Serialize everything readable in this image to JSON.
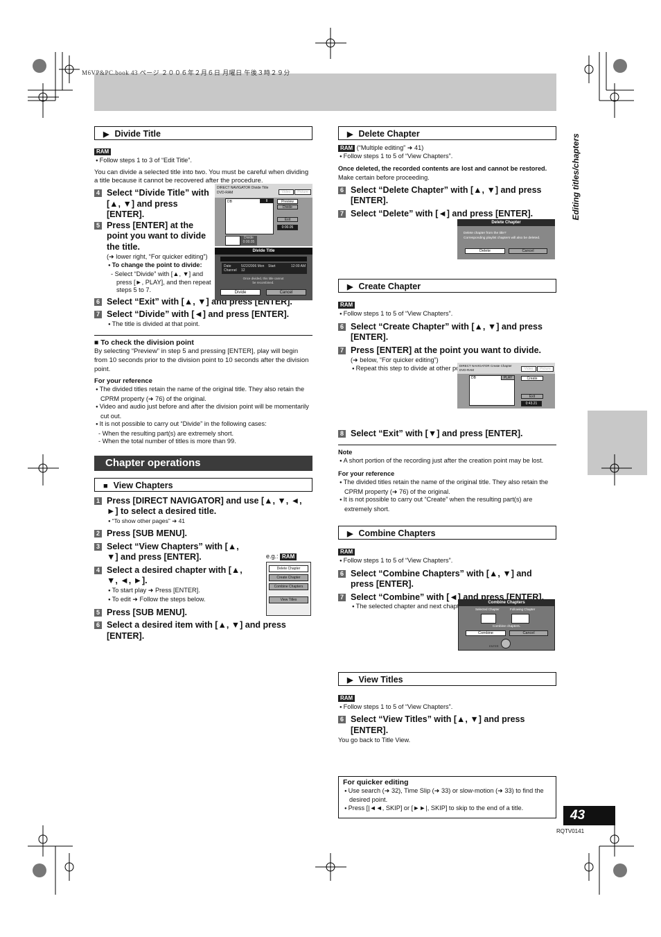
{
  "header": {
    "book_line": "M6VP&PC.book  43 ページ  ２００６年２月６日  月曜日  午後３時２９分"
  },
  "side_label": "Editing titles/chapters",
  "page_number": "43",
  "doc_code": "RQTV0141",
  "badge_ram": "RAM",
  "divide_title": {
    "heading": "Divide Title",
    "follow": "Follow steps 1 to 3 of “Edit Title”.",
    "intro": "You can divide a selected title into two. You must be careful when dividing a title because it cannot be recovered after the procedure.",
    "steps": [
      {
        "num": "4",
        "text": "Select “Divide Title” with [▲, ▼] and press [ENTER]."
      },
      {
        "num": "5",
        "text": "Press [ENTER] at the point you want to divide the title."
      },
      {
        "num": "6",
        "text": "Select “Exit” with [▲, ▼] and press [ENTER]."
      },
      {
        "num": "7",
        "text": "Select “Divide” with [◄] and press [ENTER]."
      }
    ],
    "step5_ref": "(➜ lower right, “For quicker editing”)",
    "change_point_label": "To change the point to divide:",
    "change_point_text": "- Select “Divide” with [▲, ▼] and press [►, PLAY], and then repeat steps 5 to 7.",
    "step7_note": "The title is divided at that point.",
    "check_heading": "To check the division point",
    "check_text": "By selecting “Preview” in step 5 and pressing [ENTER], play will begin from 10 seconds prior to the division point to 10 seconds after the division point.",
    "ref_heading": "For your reference",
    "ref_items": [
      "The divided titles retain the name of the original title. They also retain the CPRM property (➜ 76) of the original.",
      "Video and audio just before and after the division point will be momentarily cut out.",
      "It is not possible to carry out “Divide” in the following cases:"
    ],
    "ref_dashes": [
      "- When the resulting part(s) are extremely short.",
      "- When the total number of titles is more than 99."
    ],
    "screen": {
      "title": "DIRECT NAVIGATOR  Divide Title",
      "media": "DVD-RAM",
      "tab_video": "Video",
      "tab_picture": "Picture",
      "channel": "DB",
      "pause": "II",
      "btn_preview": "Preview",
      "btn_divide": "Divide",
      "btn_exit": "Exit",
      "time": "0:00.05",
      "thumb_label": "Divide",
      "thumb_time": "0:00.05"
    },
    "dialog": {
      "title": "Divide Title",
      "date_label": "Date",
      "date_value": "5/22/2006 Mon",
      "channel_label": "Channel",
      "channel_value": "12",
      "start_label": "Start",
      "start_value": "12:00 AM",
      "message": "Once divided, this title cannot be recombined.",
      "btn_divide": "Divide",
      "btn_cancel": "Cancel"
    }
  },
  "chapter_ops": {
    "band": "Chapter operations",
    "view_chapters": {
      "heading": "View Chapters",
      "steps": [
        {
          "num": "1",
          "text": "Press [DIRECT NAVIGATOR] and use [▲, ▼, ◄, ►] to select a desired title."
        },
        {
          "num": "2",
          "text": "Press [SUB MENU]."
        },
        {
          "num": "3",
          "text": "Select “View Chapters” with [▲, ▼] and press [ENTER]."
        },
        {
          "num": "4",
          "text": "Select a desired chapter with [▲, ▼, ◄, ►]."
        },
        {
          "num": "5",
          "text": "Press [SUB MENU]."
        },
        {
          "num": "6",
          "text": "Select a desired item with [▲, ▼] and press [ENTER]."
        }
      ],
      "step1_note": "“To show other pages” ➜ 41",
      "step4_notes": [
        "To start play ➜ Press [ENTER].",
        "To edit ➜ Follow the steps below."
      ],
      "eg_label": "e.g.:",
      "menu_items": [
        "Delete Chapter",
        "Create Chapter",
        "Combine Chapters",
        "View Titles"
      ]
    }
  },
  "delete_chapter": {
    "heading": "Delete Chapter",
    "multi": "(“Multiple editing” ➜ 41)",
    "follow": "Follow steps 1 to 5 of “View Chapters”.",
    "warning_bold": "Once deleted, the recorded contents are lost and cannot be restored.",
    "warning_rest": " Make certain before proceeding.",
    "steps": [
      {
        "num": "6",
        "text": "Select “Delete Chapter” with [▲, ▼] and press [ENTER]."
      },
      {
        "num": "7",
        "text": "Select “Delete” with [◄] and press [ENTER]."
      }
    ],
    "dialog": {
      "title": "Delete Chapter",
      "line1": "Delete chapter from the title?",
      "line2": "Corresponding playlist chapters will also be deleted.",
      "btn_delete": "Delete",
      "btn_cancel": "Cancel"
    }
  },
  "create_chapter": {
    "heading": "Create Chapter",
    "follow": "Follow steps 1 to 5 of “View Chapters”.",
    "steps": [
      {
        "num": "6",
        "text": "Select “Create Chapter” with [▲, ▼] and press [ENTER]."
      },
      {
        "num": "7",
        "text": "Press [ENTER] at the point you want to divide."
      },
      {
        "num": "8",
        "text": "Select “Exit” with [▼] and press [ENTER]."
      }
    ],
    "step7_ref": "(➜ below, “For quicker editing”)",
    "step7_note": "Repeat this step to divide at other points.",
    "screen": {
      "title": "DIRECT NAVIGATOR  Create Chapter",
      "media": "DVD-RAM",
      "tab_video": "Video",
      "tab_picture": "Picture",
      "channel": "DB",
      "play": "PLAY",
      "btn_create": "Create",
      "btn_exit": "Exit",
      "time": "0:43.21"
    },
    "note_heading": "Note",
    "note_items": [
      "A short portion of the recording just after the creation point may be lost."
    ],
    "ref_heading": "For your reference",
    "ref_items": [
      "The divided titles retain the name of the original title. They also retain the CPRM property (➜ 76) of the original.",
      "It is not possible to carry out “Create” when the resulting part(s) are extremely short."
    ]
  },
  "combine_chapters": {
    "heading": "Combine Chapters",
    "follow": "Follow steps 1 to 5 of “View Chapters”.",
    "steps": [
      {
        "num": "6",
        "text": "Select “Combine Chapters” with [▲, ▼] and press [ENTER]."
      },
      {
        "num": "7",
        "text": "Select “Combine” with [◄] and press [ENTER]."
      }
    ],
    "step7_note": "The selected chapter and next chapter are combined.",
    "dialog": {
      "title": "Combine Chapters",
      "selected": "Selected Chapter",
      "following": "Following Chapter",
      "message": "Combine chapters.",
      "btn_combine": "Combine",
      "btn_cancel": "Cancel",
      "enter": "ENTER"
    }
  },
  "view_titles": {
    "heading": "View Titles",
    "follow": "Follow steps 1 to 5 of “View Chapters”.",
    "steps": [
      {
        "num": "6",
        "text": "Select “View Titles” with [▲, ▼] and press [ENTER]."
      }
    ],
    "result": "You go back to Title View."
  },
  "quicker_editing": {
    "heading": "For quicker editing",
    "items": [
      "Use search (➜ 32), Time Slip (➜ 33) or slow-motion (➜ 33) to find the desired point.",
      "Press [|◄◄, SKIP] or [►►|, SKIP] to skip to the end of a title."
    ]
  }
}
